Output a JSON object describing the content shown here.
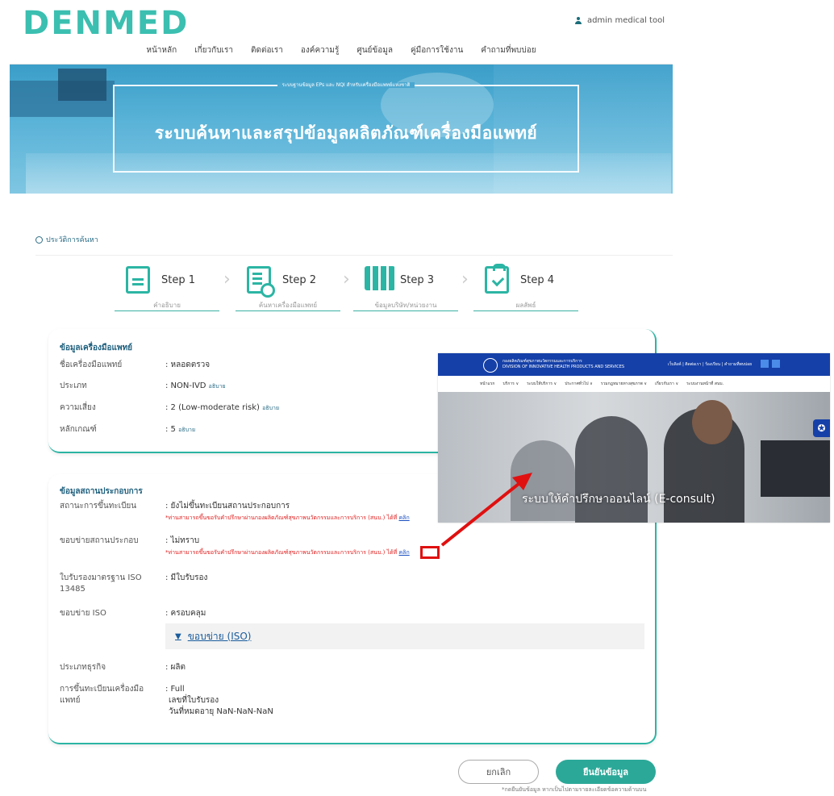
{
  "header": {
    "logo": "DENMED",
    "user": "admin medical tool"
  },
  "nav": [
    "หน้าหลัก",
    "เกี่ยวกับเรา",
    "ติดต่อเรา",
    "องค์ความรู้",
    "ศูนย์ข้อมูล",
    "คู่มือการใช้งาน",
    "คำถามที่พบบ่อย"
  ],
  "banner": {
    "subtitle": "ระบบฐานข้อมูล EPs และ NQI สำหรับเครื่องมือแพทย์แห่งชาติ",
    "title": "ระบบค้นหาและสรุปข้อมูลผลิตภัณฑ์เครื่องมือแพทย์"
  },
  "history_label": "ประวัติการค้นหา",
  "steps": [
    {
      "label": "Step 1",
      "sub": "คำอธิบาย",
      "icon": "document-icon"
    },
    {
      "label": "Step 2",
      "sub": "ค้นหาเครื่องมือแพทย์",
      "icon": "search-list-icon"
    },
    {
      "label": "Step 3",
      "sub": "ข้อมูลบริษัท/หน่วยงาน",
      "icon": "building-icon"
    },
    {
      "label": "Step 4",
      "sub": "ผลลัพธ์",
      "icon": "clipboard-check-icon"
    }
  ],
  "device_card": {
    "title": "ข้อมูลเครื่องมือแพทย์",
    "rows": [
      {
        "label": "ชื่อเครื่องมือแพทย์",
        "value": ": หลอดตรวจ",
        "extra": ""
      },
      {
        "label": "ประเภท",
        "value": ": NON-IVD",
        "extra": "อธิบาย"
      },
      {
        "label": "ความเสี่ยง",
        "value": ": 2 (Low-moderate risk)",
        "extra": "อธิบาย"
      },
      {
        "label": "หลักเกณฑ์",
        "value": ": 5",
        "extra": "อธิบาย"
      }
    ]
  },
  "company_card": {
    "title": "ข้อมูลสถานประกอบการ",
    "registration_status": {
      "label": "สถานะการขึ้นทะเบียน",
      "value": ": ยังไม่ขึ้นทะเบียนสถานประกอบการ",
      "note": "*ท่านสามารถขึ้นขอรับคำปรึกษาผ่านกองผลิตภัณฑ์สุขภาพนวัตกรรมและการบริการ (สนบ.) ได้ที่",
      "link": "คลิก"
    },
    "scope": {
      "label": "ขอบข่ายสถานประกอบ",
      "value": ": ไม่ทราบ",
      "note": "*ท่านสามารถขึ้นขอรับคำปรึกษาผ่านกองผลิตภัณฑ์สุขภาพนวัตกรรมและการบริการ (สนบ.) ได้ที่",
      "link": "คลิก"
    },
    "iso_cert": {
      "label": "ใบรับรองมาตรฐาน ISO 13485",
      "value": ": มีใบรับรอง"
    },
    "iso_scope": {
      "label": "ขอบข่าย ISO",
      "value": ": ครอบคลุม",
      "expander": "ขอบข่าย (ISO)"
    },
    "business_type": {
      "label": "ประเภทธุรกิจ",
      "value": ": ผลิต"
    },
    "device_registration": {
      "label": "การขึ้นทะเบียนเครื่องมือแพทย์",
      "value": ": Full",
      "line2": "เลขที่ใบรับรอง",
      "line3": "วันที่หมดอายุ NaN-NaN-NaN"
    }
  },
  "buttons": {
    "cancel": "ยกเลิก",
    "confirm": "ยืนยันข้อมูล",
    "confirm_note": "*กดยืนยันข้อมูล หากเป็นไปตามรายละเอียดข้อความด้านบน"
  },
  "overlay": {
    "org_th": "กองผลิตภัณฑ์สุขภาพนวัตกรรมและการบริการ",
    "org_en": "DIVISION OF INNOVATIVE HEALTH PRODUCTS AND SERVICES",
    "top_links": "เว็บลิงค์ | ติดต่อเรา | ร้องเรียน | คำถามที่พบบ่อย",
    "nav": [
      "หน้าแรก",
      "บริการ ∨",
      "ระบบให้บริการ ∨",
      "ประกาศทั่วไป ∨",
      "รวมกฎหมายทางสุขภาพ ∨",
      "เกี่ยวกับเรา ∨",
      "ระบบงานหน้าที่ สนบ."
    ],
    "title": "ระบบให้คำปรึกษาออนไลน์ (E-consult)",
    "accessibility_icon": "accessibility-icon"
  },
  "colors": {
    "brand": "#3bbfb0",
    "confirm": "#2ca898",
    "overlay_header": "#1540a8",
    "annotation": "#e01010"
  }
}
